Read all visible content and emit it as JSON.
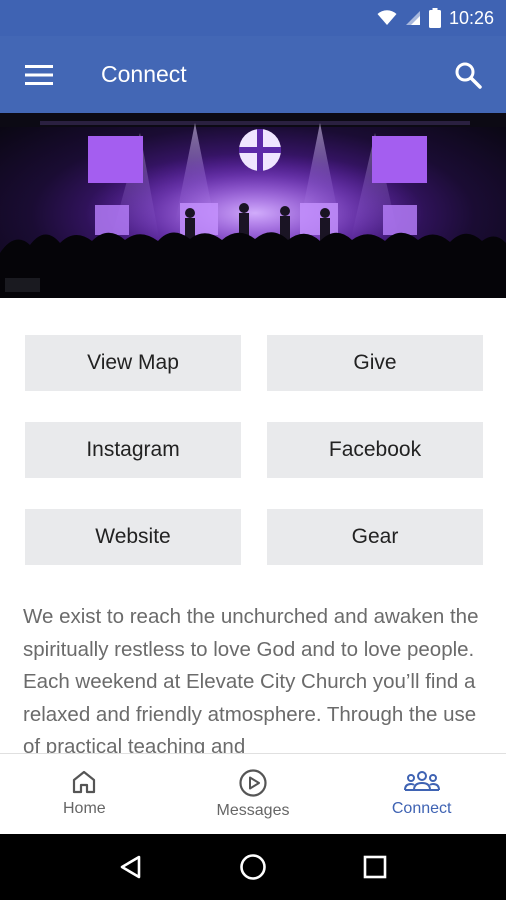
{
  "status_bar": {
    "time": "10:26"
  },
  "app_bar": {
    "title": "Connect",
    "menu_icon": "hamburger-menu-icon",
    "search_icon": "search-icon"
  },
  "hero": {
    "description_icon": "church-stage-photo"
  },
  "buttons": [
    {
      "label": "View Map"
    },
    {
      "label": "Give"
    },
    {
      "label": "Instagram"
    },
    {
      "label": "Facebook"
    },
    {
      "label": "Website"
    },
    {
      "label": "Gear"
    }
  ],
  "description": "We exist to reach the unchurched and awaken the spiritually restless to love God and to love people. Each weekend at Elevate City Church you’ll find a relaxed and friendly atmosphere. Through the use of practical teaching and",
  "bottom_nav": {
    "items": [
      {
        "label": "Home",
        "icon": "home-icon",
        "active": false
      },
      {
        "label": "Messages",
        "icon": "play-circle-icon",
        "active": false
      },
      {
        "label": "Connect",
        "icon": "people-group-icon",
        "active": true
      }
    ]
  },
  "colors": {
    "primary": "#4367b5",
    "active_nav": "#3f63b3",
    "button_bg": "#e9eaec"
  }
}
